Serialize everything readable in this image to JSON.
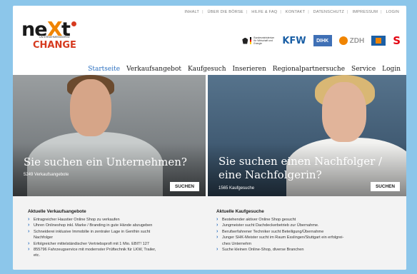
{
  "topnav": [
    "INHALT",
    "ÜBER DIE BÖRSE",
    "HILFE & FAQ",
    "KONTAKT",
    "DATENSCHUTZ",
    "IMPRESSUM",
    "LOGIN"
  ],
  "logo": {
    "main_left": "ne",
    "main_x": "X",
    "main_right": "t",
    "subtitle": "UNTERNEHMENSBÖRSE",
    "change": "CHANGE"
  },
  "partners": {
    "bmwi_text": "Bundesministerium für Wirtschaft und Energie",
    "kfw": "KFW",
    "dihk": "DIHK",
    "zdh": "ZDH",
    "sparkasse": "S"
  },
  "mainnav": [
    "Startseite",
    "Verkaufsangebot",
    "Kaufgesuch",
    "Inserieren",
    "Regionalpartnersuche",
    "Service",
    "Login"
  ],
  "hero": {
    "left": {
      "title": "Sie suchen ein Unternehmen?",
      "count": "5249 Verkaufsangebote",
      "button": "SUCHEN"
    },
    "right": {
      "title_line1": "Sie suchen einen Nachfolger /",
      "title_line2": "eine Nachfolgerin?",
      "count": "1565 Kaufgesuche",
      "button": "SUCHEN"
    }
  },
  "offers": {
    "heading": "Aktuelle Verkaufsangebote",
    "items": [
      "Ertragreicher Haustier Online Shop zu verkaufen",
      "Uhren Onlineshop inkl. Marke / Branding in gute Hände abzugeben",
      "Schneiderei inklusive Immobilie in zentraler Lage in Genthin sucht",
      "Nachfolger",
      "Erfolgreicher mittelständischer Vertriebsprofi mit 1 Mio. EBIT! 127",
      "855796 Fahrzeugservice mit modernster Prüftechnik für LKW, Trailer,",
      "etc."
    ]
  },
  "requests": {
    "heading": "Aktuelle Kaufgesuche",
    "items": [
      "Bestehender aktiver Online Shop gesucht",
      "Jungmeister sucht Dachdeckerbetrieb zur Übernahme.",
      "Berufserfahrener Techniker sucht Beteiligung/Übernahme",
      "Junger SHK-Meister sucht im Raum Esslingen/Stuttgart ein erfolgrei-",
      "ches Unternehm",
      "Suche kleinen Online-Shop, diverse Branchen"
    ]
  },
  "colors": {
    "background": "#8cc6ea",
    "accent_blue": "#2a6fbf",
    "brand_orange": "#f08400",
    "brand_red": "#d63a1f"
  }
}
